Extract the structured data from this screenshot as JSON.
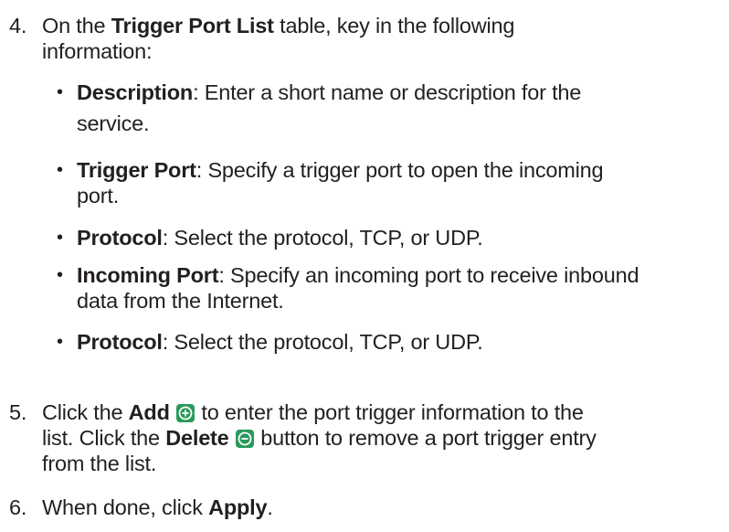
{
  "step4": {
    "number": "4.",
    "text_a": "On the ",
    "bold": "Trigger Port List",
    "text_b": " table, key in the following",
    "line2": "information:"
  },
  "bullets": [
    {
      "bold": "Description",
      "line1": ": Enter a short name or description for the",
      "line2": "service."
    },
    {
      "bold": "Trigger Port",
      "line1": ": Specify a trigger port to open the incoming",
      "line2": "port."
    },
    {
      "bold": "Protocol",
      "line1": ": Select the protocol, TCP, or UDP.",
      "line2": ""
    },
    {
      "bold": "Incoming Port",
      "line1": ": Specify an incoming port to receive inbound",
      "line2": "data from the Internet."
    },
    {
      "bold": "Protocol",
      "line1": ": Select the protocol, TCP, or UDP.",
      "line2": ""
    }
  ],
  "step5": {
    "number": "5.",
    "text_a": "Click the ",
    "add_bold": "Add",
    "text_b": " to enter the port trigger information to the",
    "line2_a": "list. Click the ",
    "delete_bold": "Delete",
    "line2_b": " button to remove a port trigger entry",
    "line3": "from the list."
  },
  "step6": {
    "number": "6.",
    "text_a": "When done, click ",
    "bold": "Apply",
    "text_b": "."
  },
  "colors": {
    "text": "#231f20",
    "add_icon_bg": "#2a9a5a",
    "delete_icon_bg": "#2a9a5a"
  },
  "icons": {
    "add": "plus-circle-icon",
    "delete": "minus-circle-icon"
  }
}
